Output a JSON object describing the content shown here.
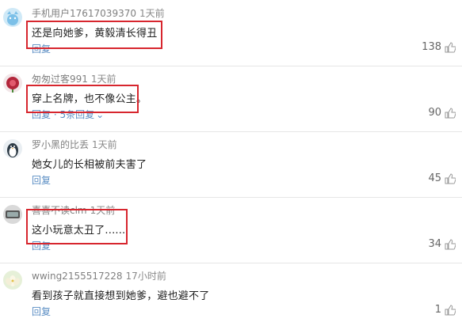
{
  "comments": [
    {
      "user": "手机用户17617039370",
      "time": "1天前",
      "text": "还是向她爹，黄毅清长得丑",
      "reply": "回复",
      "replies": "",
      "likes": "138",
      "avatar_icon": "cat-icon"
    },
    {
      "user": "匆匆过客991",
      "time": "1天前",
      "text": "穿上名牌，也不像公主。",
      "reply": "回复",
      "replies": " · 5条回复",
      "likes": "90",
      "avatar_icon": "flower-icon"
    },
    {
      "user": "罗小黑的比丢",
      "time": "1天前",
      "text": "她女儿的长相被前夫害了",
      "reply": "回复",
      "replies": "",
      "likes": "45",
      "avatar_icon": "penguin-icon"
    },
    {
      "user": "喜喜不读clm",
      "time": "1天前",
      "text": "这小玩意太丑了......",
      "reply": "回复",
      "replies": "",
      "likes": "34",
      "avatar_icon": "device-icon"
    },
    {
      "user": "wwing2155517228",
      "time": "17小时前",
      "text": "看到孩子就直接想到她爹，避也避不了",
      "reply": "回复",
      "replies": "",
      "likes": "1",
      "avatar_icon": "lotus-icon"
    }
  ],
  "colors": {
    "highlight": "#d7262e",
    "link": "#5a8dc3",
    "meta": "#808080"
  }
}
